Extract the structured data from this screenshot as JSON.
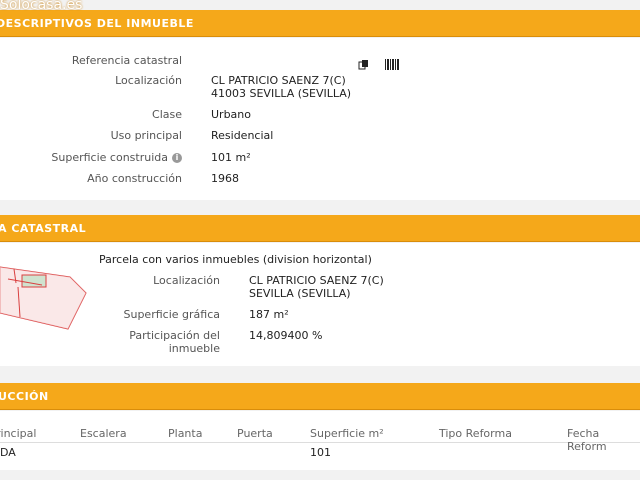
{
  "watermark": "Solocasa.es",
  "section1": {
    "title": "DESCRIPTIVOS DEL INMUEBLE",
    "rows": [
      {
        "label": "Referencia catastral",
        "value": ""
      },
      {
        "label": "Localización",
        "value1": "CL PATRICIO SAENZ 7(C)",
        "value2": "41003 SEVILLA (SEVILLA)"
      },
      {
        "label": "Clase",
        "value": "Urbano"
      },
      {
        "label": "Uso principal",
        "value": "Residencial"
      },
      {
        "label": "Superficie construida",
        "value": "101 m²"
      },
      {
        "label": "Año construcción",
        "value": "1968"
      }
    ]
  },
  "section2": {
    "title": "A CATASTRAL",
    "subtitle": "Parcela con varios inmuebles (division horizontal)",
    "rows": [
      {
        "label": "Localización",
        "value1": "CL PATRICIO SAENZ 7(C)",
        "value2": "SEVILLA (SEVILLA)"
      },
      {
        "label": "Superficie gráfica",
        "value": "187 m²"
      },
      {
        "label1": "Participación del",
        "label2": "inmueble",
        "value": "14,809400 %"
      }
    ]
  },
  "section3": {
    "title": "UCCIÓN",
    "headers": [
      "rincipal",
      "Escalera",
      "Planta",
      "Puerta",
      "Superficie m²",
      "Tipo Reforma",
      "Fecha Reform"
    ],
    "row": [
      "DA",
      "",
      "",
      "",
      "101",
      "",
      ""
    ]
  }
}
